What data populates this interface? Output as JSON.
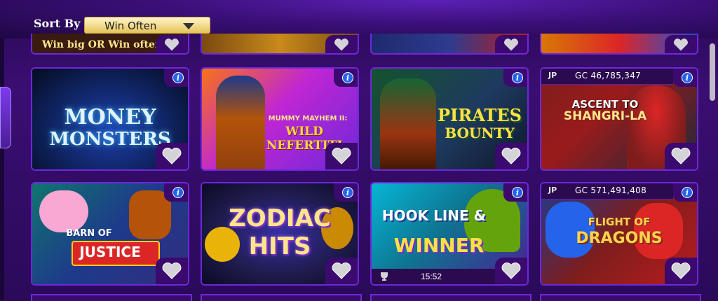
{
  "sort": {
    "label": "Sort By :",
    "selected": "Win Often"
  },
  "top_partial_row": [
    {
      "caption": "Win big  OR  Win often"
    },
    {
      "caption": ""
    },
    {
      "caption": ""
    },
    {
      "caption": ""
    }
  ],
  "games": [
    {
      "id": "money-monsters",
      "title_line1": "MONEY",
      "title_line2": "MONSTERS",
      "accent": "#38bdf8"
    },
    {
      "id": "wild-nefertiti",
      "title_line1": "MUMMY MAYHEM II:",
      "title_line2": "WILD NEFERTITI",
      "accent": "#f59e0b"
    },
    {
      "id": "pirates-bounty",
      "title_line1": "PIRATES",
      "title_line2": "BOUNTY",
      "accent": "#84cc16"
    },
    {
      "id": "ascent-to-shangri-la",
      "title_line1": "ASCENT TO",
      "title_line2": "SHANGRI-LA",
      "accent": "#ef4444",
      "jackpot": {
        "icon": "JP",
        "value": "GC 46,785,347"
      }
    },
    {
      "id": "barn-of-justice",
      "title_line1": "BARN OF",
      "title_line2": "JUSTICE",
      "accent": "#ef4444"
    },
    {
      "id": "zodiac-hits",
      "title_line1": "ZODIAC",
      "title_line2": "HITS",
      "accent": "#a78bfa"
    },
    {
      "id": "hook-line-winner",
      "title_line1": "HOOK LINE &",
      "title_line2": "WINNER",
      "accent": "#22d3ee",
      "timer": "15:52"
    },
    {
      "id": "flight-of-dragons",
      "title_line1": "FLIGHT OF",
      "title_line2": "DRAGONS",
      "accent": "#f97316",
      "jackpot": {
        "icon": "JP",
        "value": "GC 571,491,408"
      }
    }
  ],
  "icons": {
    "info": "i",
    "favorite": "heart-icon",
    "trophy": "trophy-icon"
  }
}
